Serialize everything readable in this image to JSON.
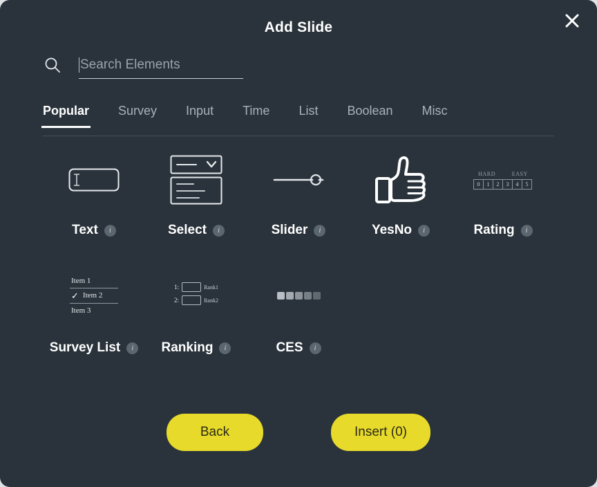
{
  "modal": {
    "title": "Add Slide",
    "close_icon": "close-icon",
    "accent_color": "#e7da2b",
    "background_color": "#2a333b"
  },
  "search": {
    "icon": "search-icon",
    "placeholder": "Search Elements",
    "value": ""
  },
  "tabs": [
    {
      "label": "Popular",
      "active": true
    },
    {
      "label": "Survey",
      "active": false
    },
    {
      "label": "Input",
      "active": false
    },
    {
      "label": "Time",
      "active": false
    },
    {
      "label": "List",
      "active": false
    },
    {
      "label": "Boolean",
      "active": false
    },
    {
      "label": "Misc",
      "active": false
    }
  ],
  "elements": {
    "row1": [
      {
        "label": "Text",
        "icon": "text-field-icon",
        "info": "i"
      },
      {
        "label": "Select",
        "icon": "dropdown-select-icon",
        "info": "i"
      },
      {
        "label": "Slider",
        "icon": "slider-icon",
        "info": "i"
      },
      {
        "label": "YesNo",
        "icon": "thumbs-up-icon",
        "info": "i"
      },
      {
        "label": "Rating",
        "icon": "rating-scale-icon",
        "info": "i"
      }
    ],
    "row2": [
      {
        "label": "Survey List",
        "icon": "survey-list-icon",
        "info": "i"
      },
      {
        "label": "Ranking",
        "icon": "ranking-icon",
        "info": "i"
      },
      {
        "label": "CES",
        "icon": "ces-scale-icon",
        "info": "i"
      }
    ]
  },
  "rating_icon": {
    "left_label": "HARD",
    "right_label": "EASY",
    "cells": [
      "0",
      "1",
      "2",
      "3",
      "4",
      "5"
    ]
  },
  "survey_list_icon": {
    "items": [
      "Item 1",
      "Item 2",
      "Item 3"
    ],
    "checked_index": 1,
    "check_glyph": "✓"
  },
  "ranking_icon": {
    "rows": [
      {
        "number": "1:",
        "label": "Rank1"
      },
      {
        "number": "2:",
        "label": "Rank2"
      }
    ]
  },
  "ces_icon": {
    "swatches": [
      "#b9bfc4",
      "#a3aab0",
      "#8d949b",
      "#777f86",
      "#616970"
    ]
  },
  "footer": {
    "back_label": "Back",
    "insert_label": "Insert (0)"
  }
}
